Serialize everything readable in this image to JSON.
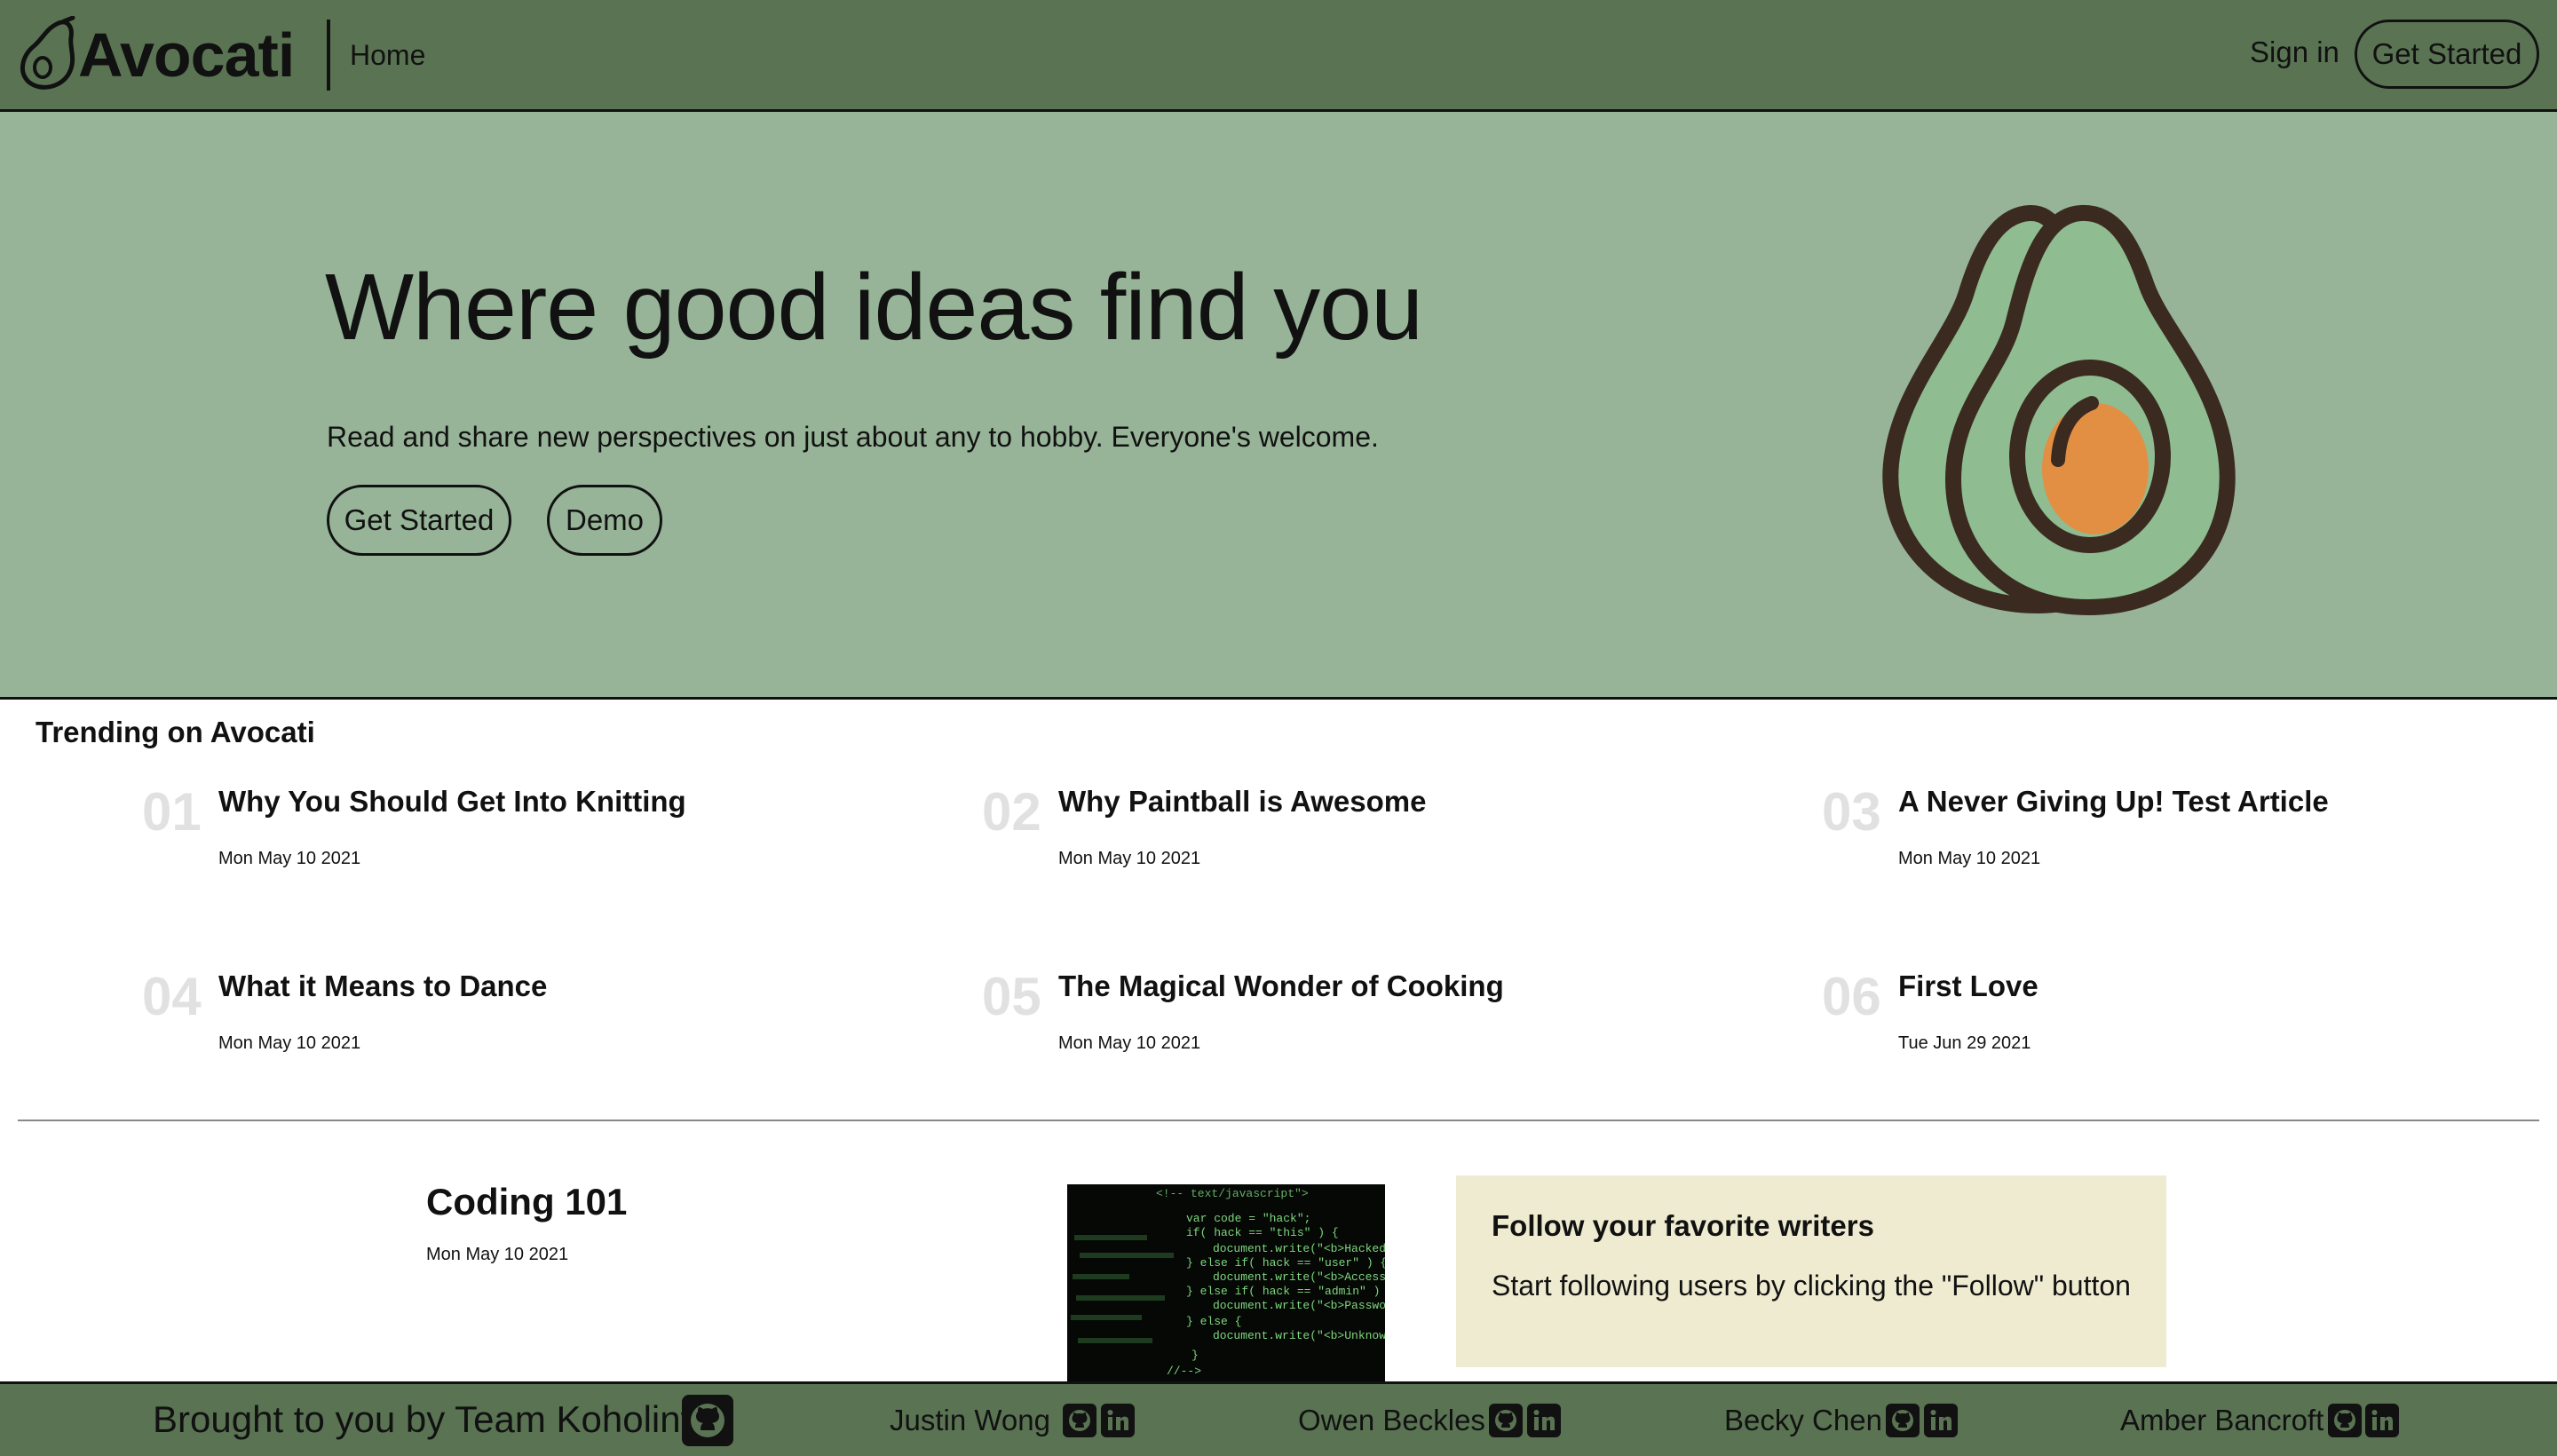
{
  "nav": {
    "brand": "Avocati",
    "home_label": "Home",
    "signin_label": "Sign in",
    "cta_label": "Get Started"
  },
  "hero": {
    "title": "Where good ideas find you",
    "subtitle": "Read and share new perspectives on just about any to hobby. Everyone's welcome.",
    "primary_label": "Get Started",
    "secondary_label": "Demo"
  },
  "trending": {
    "heading": "Trending on Avocati",
    "items": [
      {
        "num": "01",
        "title": "Why You Should Get Into Knitting",
        "date": "Mon May 10 2021"
      },
      {
        "num": "02",
        "title": "Why Paintball is Awesome",
        "date": "Mon May 10 2021"
      },
      {
        "num": "03",
        "title": "A Never Giving Up! Test Article",
        "date": "Mon May 10 2021"
      },
      {
        "num": "04",
        "title": "What it Means to Dance",
        "date": "Mon May 10 2021"
      },
      {
        "num": "05",
        "title": "The Magical Wonder of Cooking",
        "date": "Mon May 10 2021"
      },
      {
        "num": "06",
        "title": "First Love",
        "date": "Tue Jun 29 2021"
      }
    ]
  },
  "feed": {
    "title": "Coding 101",
    "date": "Mon May 10 2021",
    "thumbnail_icon": "code-screen-image"
  },
  "follow": {
    "title": "Follow your favorite writers",
    "text": "Start following users by clicking the \"Follow\" button"
  },
  "footer": {
    "credit": "Brought to you by Team Koholint",
    "members": [
      {
        "name": "Justin Wong"
      },
      {
        "name": "Owen Beckles"
      },
      {
        "name": "Becky Chen"
      },
      {
        "name": "Amber Bancroft"
      }
    ]
  },
  "colors": {
    "nav_bg": "#5a7453",
    "hero_bg": "#97b498",
    "follow_bg": "#efebd0",
    "avocado_flesh": "#8fbc90",
    "avocado_pit": "#e38f43",
    "avocado_outline": "#3b2a20"
  }
}
